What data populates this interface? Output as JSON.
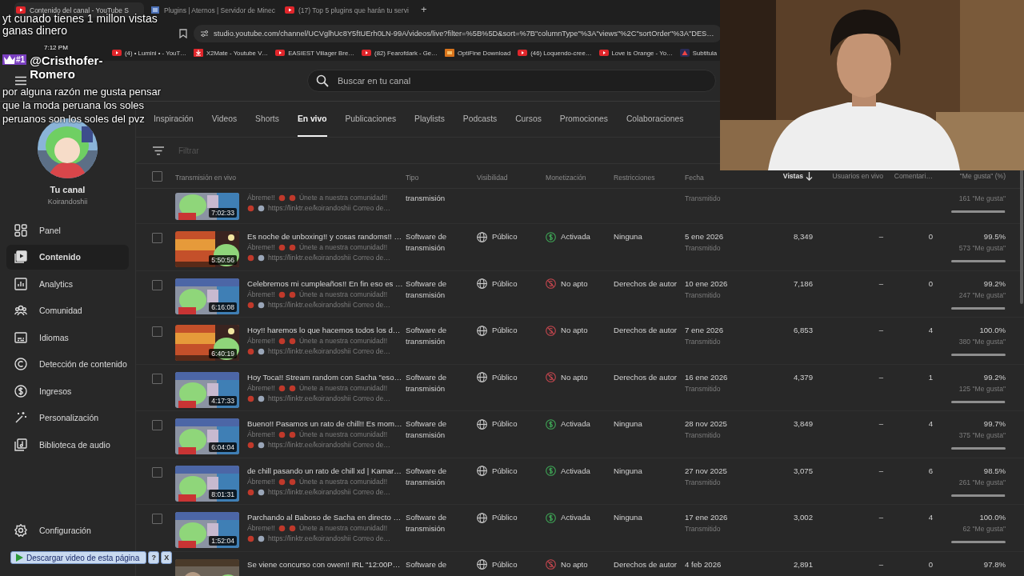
{
  "browser": {
    "tabs": [
      {
        "title": "Contenido del canal - YouTube S",
        "selected": true
      },
      {
        "title": "Plugins | Aternos | Servidor de Minec",
        "selected": false
      },
      {
        "title": "(17) Top 5 plugins que harán tu servi",
        "selected": false
      }
    ],
    "new_tab": "+",
    "url": "studio.youtube.com/channel/UCVglhUc8Y5ftUErh0LN-99A/videos/live?filter=%5B%5D&sort=%7B\"columnType\"%3A\"views\"%2C\"sortOrder\"%3A\"DES…",
    "bookmarks": [
      {
        "title": "(4) • Lumini • - YouT…",
        "kind": "youtube"
      },
      {
        "title": "X2Mate - Youtube V…",
        "kind": "download"
      },
      {
        "title": "EASIEST Villager Bre…",
        "kind": "youtube"
      },
      {
        "title": "(82) Fearofdark - Ge…",
        "kind": "youtube"
      },
      {
        "title": "OptiFine Download",
        "kind": "optifine"
      },
      {
        "title": "(46) Loquendo-cree…",
        "kind": "youtube"
      },
      {
        "title": "Love is Orange - Yo…",
        "kind": "youtube"
      },
      {
        "title": "Subtitula",
        "kind": "app"
      }
    ]
  },
  "overlay": {
    "message_1": [
      "yt cunado tienes 1 millon vistas",
      "ganas dinero"
    ],
    "time": "7:12 PM",
    "badge": "#1",
    "user": [
      "@Cristhofer-",
      "Romero"
    ],
    "message_2": [
      "por alguna razón me gusta pensar",
      "que la moda peruana los soles",
      "peruanos son los soles del pvz"
    ]
  },
  "search": {
    "placeholder": "Buscar en tu canal"
  },
  "channel": {
    "title": "Tu canal",
    "handle": "Koirandoshii"
  },
  "nav": [
    {
      "label": "Panel",
      "kind": "panel",
      "selected": false
    },
    {
      "label": "Contenido",
      "kind": "content",
      "selected": true
    },
    {
      "label": "Analytics",
      "kind": "analytics",
      "selected": false
    },
    {
      "label": "Comunidad",
      "kind": "community",
      "selected": false
    },
    {
      "label": "Idiomas",
      "kind": "languages",
      "selected": false
    },
    {
      "label": "Detección de contenido",
      "kind": "copyright",
      "selected": false
    },
    {
      "label": "Ingresos",
      "kind": "earn",
      "selected": false
    },
    {
      "label": "Personalización",
      "kind": "customize",
      "selected": false
    },
    {
      "label": "Biblioteca de audio",
      "kind": "audio",
      "selected": false
    }
  ],
  "settings": {
    "label": "Configuración"
  },
  "tabs": [
    {
      "label": "Inspiración",
      "selected": false
    },
    {
      "label": "Videos",
      "selected": false
    },
    {
      "label": "Shorts",
      "selected": false
    },
    {
      "label": "En vivo",
      "selected": true
    },
    {
      "label": "Publicaciones",
      "selected": false
    },
    {
      "label": "Playlists",
      "selected": false
    },
    {
      "label": "Podcasts",
      "selected": false
    },
    {
      "label": "Cursos",
      "selected": false
    },
    {
      "label": "Promociones",
      "selected": false
    },
    {
      "label": "Colaboraciones",
      "selected": false
    }
  ],
  "filter": {
    "placeholder": "Filtrar"
  },
  "table": {
    "select_all": false,
    "columns": [
      {
        "label": "Transmisión en vivo",
        "sorted": false
      },
      {
        "label": "Tipo",
        "sorted": false
      },
      {
        "label": "Visibilidad",
        "sorted": false
      },
      {
        "label": "Monetización",
        "sorted": false
      },
      {
        "label": "Restricciones",
        "sorted": false
      },
      {
        "label": "Fecha",
        "sorted": false
      },
      {
        "label": "Vistas",
        "sorted": true
      },
      {
        "label": "Usuarios en vivo",
        "sorted": false
      },
      {
        "label": "Comentari…",
        "sorted": false
      },
      {
        "label": "\"Me gusta\" (%)",
        "sorted": false
      }
    ],
    "rows": [
      {
        "kind": "partial",
        "desc": [
          "Ábreme!!",
          "Únete a nuestra comunidad!!"
        ],
        "link": "https://linktr.ee/koirandoshii Correo de…",
        "duration": "7:02:33",
        "type": "transmisión",
        "status": "Transmitido",
        "likes_count": "161 \"Me gusta\"",
        "level": 0.99
      },
      {
        "kind": "full",
        "selected": false,
        "title": "Es noche de unboxing!! y cosas randoms!! …",
        "desc": [
          "Ábreme!!",
          "Únete a nuestra comunidad!!"
        ],
        "link": "https://linktr.ee/koirandoshii Correo de…",
        "duration": "5:50:56",
        "type": "Software de transmisión",
        "visibility": "Público",
        "monetized": true,
        "monetization": "Activada",
        "restrictions": "Ninguna",
        "date": "5 ene 2026",
        "status": "Transmitido",
        "views": "8,349",
        "live_users": "–",
        "comments": "0",
        "likes_pct": "99.5%",
        "likes_count": "573 \"Me gusta\"",
        "level": 0.995
      },
      {
        "kind": "full",
        "selected": false,
        "title": "Celebremos mi cumpleaños!! En fin eso es …",
        "desc": [
          "Ábreme!!",
          "Únete a nuestra comunidad!!"
        ],
        "link": "https://linktr.ee/koirandoshii Correo de…",
        "duration": "6:16:08",
        "type": "Software de transmisión",
        "visibility": "Público",
        "monetized": false,
        "monetization": "No apto",
        "restrictions": "Derechos de autor",
        "date": "10 ene 2026",
        "status": "Transmitido",
        "views": "7,186",
        "live_users": "–",
        "comments": "0",
        "likes_pct": "99.2%",
        "likes_count": "247 \"Me gusta\"",
        "level": 0.992
      },
      {
        "kind": "full",
        "selected": false,
        "title": "Hoy!! haremos lo que hacemos todos los d…",
        "desc": [
          "Ábreme!!",
          "Únete a nuestra comunidad!!"
        ],
        "link": "https://linktr.ee/koirandoshii Correo de…",
        "duration": "6:40:19",
        "type": "Software de transmisión",
        "visibility": "Público",
        "monetized": false,
        "monetization": "No apto",
        "restrictions": "Derechos de autor",
        "date": "7 ene 2026",
        "status": "Transmitido",
        "views": "6,853",
        "live_users": "–",
        "comments": "4",
        "likes_pct": "100.0%",
        "likes_count": "380 \"Me gusta\"",
        "level": 1.0
      },
      {
        "kind": "full",
        "selected": false,
        "title": "Hoy Toca!! Stream random con Sacha \"eso…",
        "desc": [
          "Ábreme!!",
          "Únete a nuestra comunidad!!"
        ],
        "link": "https://linktr.ee/koirandoshii Correo de…",
        "duration": "4:17:33",
        "type": "Software de transmisión",
        "visibility": "Público",
        "monetized": false,
        "monetization": "No apto",
        "restrictions": "Derechos de autor",
        "date": "16 ene 2026",
        "status": "Transmitido",
        "views": "4,379",
        "live_users": "–",
        "comments": "1",
        "likes_pct": "99.2%",
        "likes_count": "125 \"Me gusta\"",
        "level": 0.992
      },
      {
        "kind": "full",
        "selected": false,
        "title": "Bueno!! Pasamos un rato de chill!! Es mom…",
        "desc": [
          "Ábreme!!",
          "Únete a nuestra comunidad!!"
        ],
        "link": "https://linktr.ee/koirandoshii Correo de…",
        "duration": "6:04:04",
        "type": "Software de transmisión",
        "visibility": "Público",
        "monetized": true,
        "monetization": "Activada",
        "restrictions": "Ninguna",
        "date": "28 nov 2025",
        "status": "Transmitido",
        "views": "3,849",
        "live_users": "–",
        "comments": "4",
        "likes_pct": "99.7%",
        "likes_count": "375 \"Me gusta\"",
        "level": 0.997
      },
      {
        "kind": "full",
        "selected": false,
        "title": "de chill pasando un rato de chill xd | Kamar…",
        "desc": [
          "Ábreme!!",
          "Únete a nuestra comunidad!!"
        ],
        "link": "https://linktr.ee/koirandoshii Correo de…",
        "duration": "8:01:31",
        "type": "Software de transmisión",
        "visibility": "Público",
        "monetized": true,
        "monetization": "Activada",
        "restrictions": "Ninguna",
        "date": "27 nov 2025",
        "status": "Transmitido",
        "views": "3,075",
        "live_users": "–",
        "comments": "6",
        "likes_pct": "98.5%",
        "likes_count": "261 \"Me gusta\"",
        "level": 0.985
      },
      {
        "kind": "full",
        "selected": false,
        "title": "Parchando al Baboso de Sacha en directo …",
        "desc": [
          "Ábreme!!",
          "Únete a nuestra comunidad!!"
        ],
        "link": "https://linktr.ee/koirandoshii Correo de…",
        "duration": "1:52:04",
        "type": "Software de transmisión",
        "visibility": "Público",
        "monetized": true,
        "monetization": "Activada",
        "restrictions": "Ninguna",
        "date": "17 ene 2026",
        "status": "Transmitido",
        "views": "3,002",
        "live_users": "–",
        "comments": "4",
        "likes_pct": "100.0%",
        "likes_count": "62 \"Me gusta\"",
        "level": 1.0
      },
      {
        "kind": "full",
        "title": "Se viene concurso con owen!! IRL \"12:00P…",
        "type": "Software de",
        "visibility": "Público",
        "monetized": false,
        "monetization": "No apto",
        "restrictions": "Derechos de autor",
        "date": "4 feb 2026",
        "views": "2,891",
        "live_users": "–",
        "comments": "0",
        "likes_pct": "97.8%"
      }
    ]
  },
  "download_bar": {
    "label": "Descargar video de esta página",
    "help": "?",
    "close": "X"
  }
}
